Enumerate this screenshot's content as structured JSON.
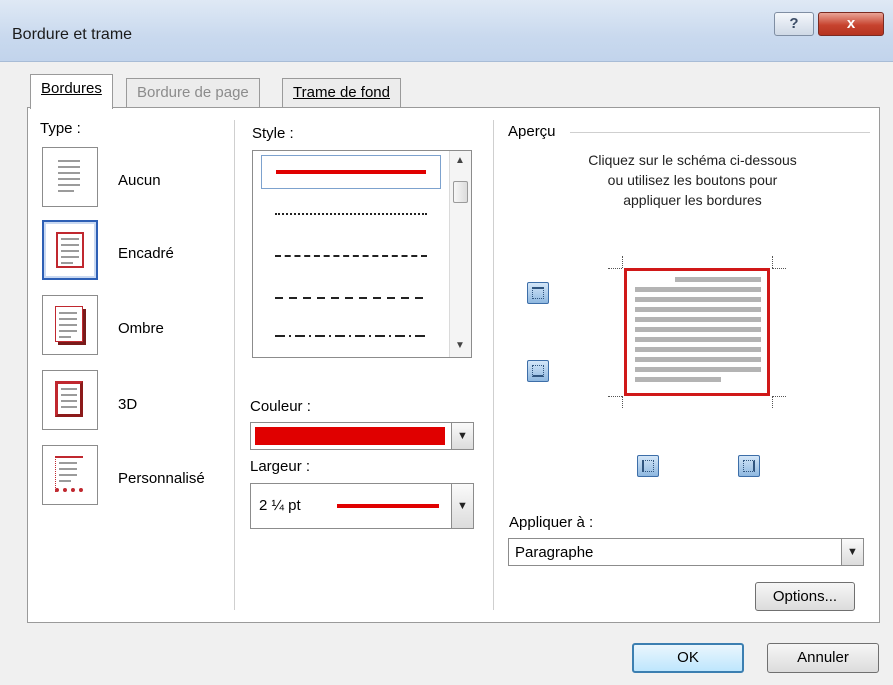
{
  "window": {
    "title": "Bordure et trame",
    "help_label": "?",
    "close_label": "x"
  },
  "tabs": [
    {
      "label": "Bordures",
      "state": "active"
    },
    {
      "label": "Bordure de page",
      "state": "disabled"
    },
    {
      "label": "Trame de fond",
      "state": "normal"
    }
  ],
  "type_section": {
    "label": "Type :",
    "items": [
      {
        "label": "Aucun",
        "selected": false
      },
      {
        "label": "Encadré",
        "selected": true
      },
      {
        "label": "Ombre",
        "selected": false
      },
      {
        "label": "3D",
        "selected": false
      },
      {
        "label": "Personnalisé",
        "selected": false
      }
    ]
  },
  "style_section": {
    "label": "Style :",
    "selected_index": 0
  },
  "color_section": {
    "label": "Couleur :",
    "value_color": "#e00000"
  },
  "width_section": {
    "label": "Largeur :",
    "value": "2 ¼ pt"
  },
  "preview_section": {
    "label": "Aperçu",
    "instructions": [
      "Cliquez sur le schéma ci-dessous",
      "ou utilisez les boutons pour",
      "appliquer les bordures"
    ]
  },
  "apply_to": {
    "label": "Appliquer à :",
    "value": "Paragraphe"
  },
  "buttons": {
    "options": "Options...",
    "ok": "OK",
    "cancel": "Annuler"
  },
  "colors": {
    "accent_red": "#e00000",
    "selection_blue": "#2d5fb5"
  }
}
